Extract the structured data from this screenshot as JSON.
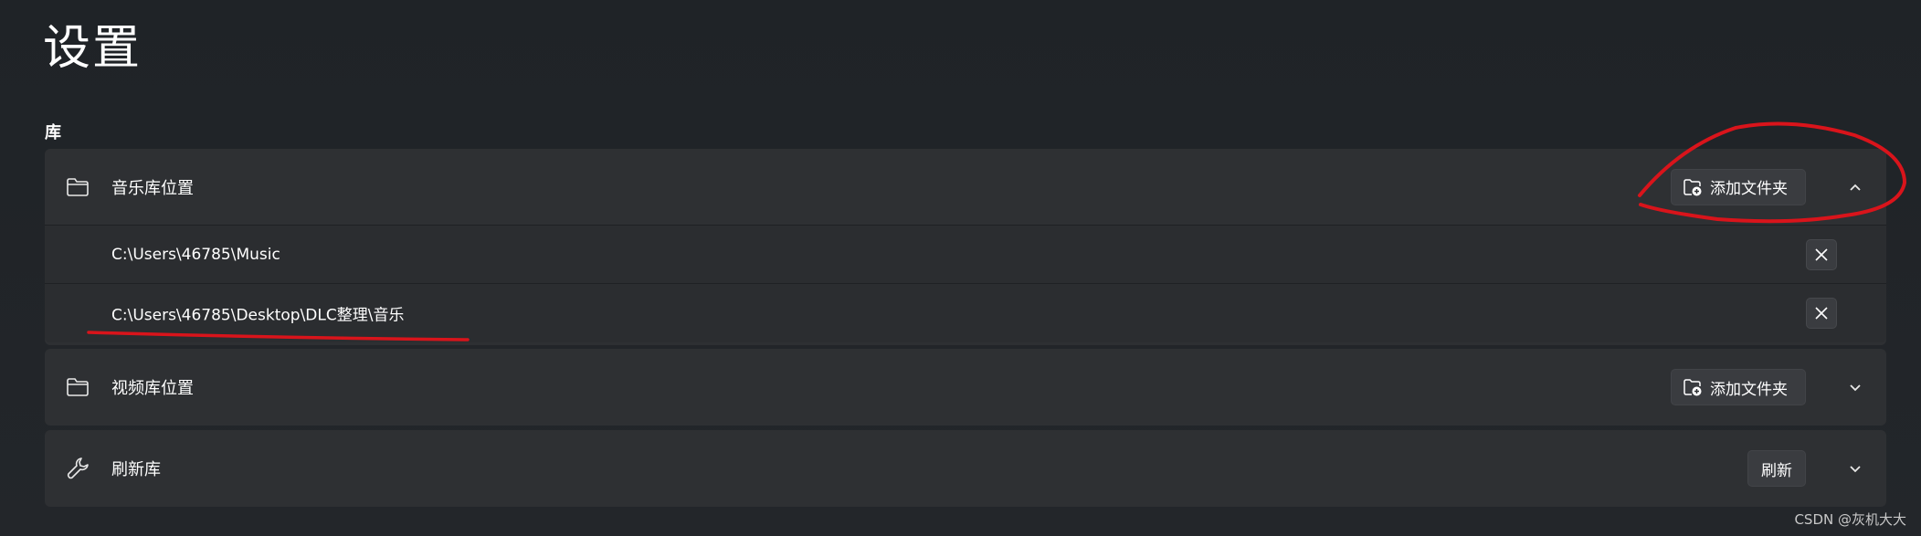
{
  "page": {
    "title": "设置"
  },
  "section": {
    "label": "库"
  },
  "music": {
    "label": "音乐库位置",
    "add_button": "添加文件夹",
    "folders": [
      "C:\\Users\\46785\\Music",
      "C:\\Users\\46785\\Desktop\\DLC整理\\音乐"
    ]
  },
  "video": {
    "label": "视频库位置",
    "add_button": "添加文件夹"
  },
  "refresh": {
    "label": "刷新库",
    "button": "刷新"
  },
  "watermark": "CSDN @灰机大大",
  "colors": {
    "annotation": "#d9141b",
    "background": "#202124",
    "card": "#2e3033"
  },
  "icons": {
    "music": "folder-icon",
    "video": "folder-icon",
    "refresh": "wrench-icon",
    "add": "folder-add-icon",
    "remove": "close-icon",
    "expanded": "chevron-up-icon",
    "collapsed": "chevron-down-icon"
  }
}
